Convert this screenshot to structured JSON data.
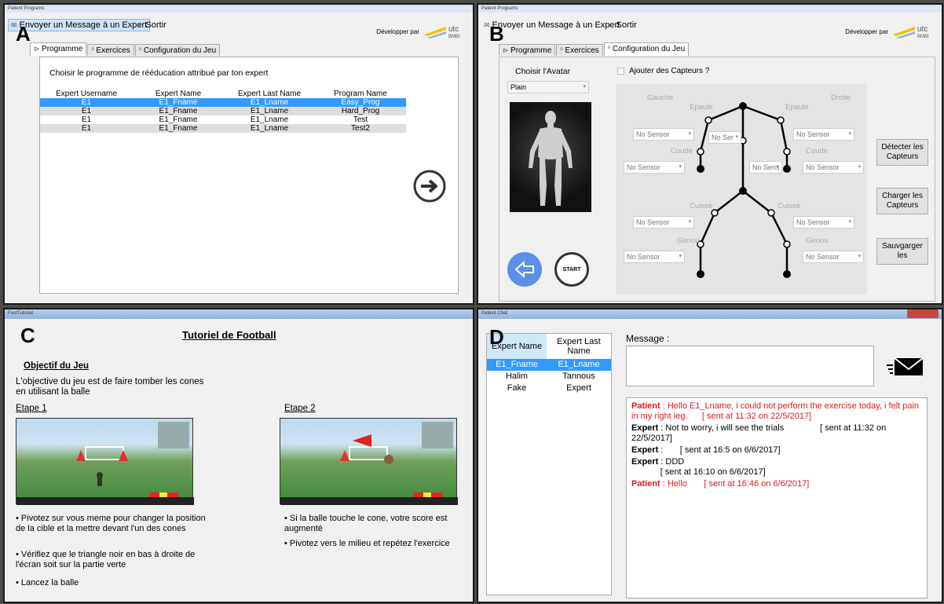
{
  "labels": {
    "a": "A",
    "b": "B",
    "c": "C",
    "d": "D"
  },
  "program_window": {
    "title": "Patient Programs",
    "menu": {
      "message": "Envoyer un Message à un Expert",
      "exit": "Sortir"
    },
    "developer": "Développer par",
    "logo_text": "utc",
    "logo_sub": "BMBI",
    "tabs": [
      "Programme",
      "Exercices",
      "Configuration du Jeu"
    ]
  },
  "panel_a": {
    "prompt": "Choisir le programme de rééducation attribué par ton expert",
    "columns": [
      "Expert Username",
      "Expert Name",
      "Expert Last Name",
      "Program Name"
    ],
    "rows": [
      [
        "E1",
        "E1_Fname",
        "E1_Lname",
        "Easy_Prog"
      ],
      [
        "E1",
        "E1_Fname",
        "E1_Lname",
        "Hard_Prog"
      ],
      [
        "E1",
        "E1_Fname",
        "E1_Lname",
        "Test"
      ],
      [
        "E1",
        "E1_Fname",
        "E1_Lname",
        "Test2"
      ]
    ],
    "selected_row": 0
  },
  "panel_b": {
    "avatar_label": "Choisir l'Avatar",
    "avatar_value": "Plain",
    "sensor_checkbox": "Ajouter des Capteurs ?",
    "side_left": "Gauche",
    "side_right": "Droite",
    "joint_shoulder": "Epaule",
    "joint_elbow": "Coude",
    "joint_thigh": "Cuisse",
    "joint_knee": "Genou",
    "sensor_default": "No Sensor",
    "sensor_short": "No Ser",
    "sensor_short2": "No Sens",
    "btn_detect": "Détecter les Capteurs",
    "btn_load": "Charger les Capteurs",
    "btn_save": "Sauvgarger les",
    "start": "START"
  },
  "panel_c": {
    "window_title": "FootTutorial",
    "title": "Tutoriel de Football",
    "objective_heading": "Objectif du Jeu",
    "objective_text": "L'objective du jeu est de faire tomber les cones en utilisant la balle",
    "step1": "Etape 1",
    "step2": "Etape 2",
    "step1_points": [
      "• Pivotez sur vous meme pour changer la position de la cible et la mettre devant l'un des cones",
      "• Vérifiez que le triangle noir en bas à droite de l'écran soit sur la partie verte",
      "• Lancez la balle"
    ],
    "step2_points": [
      "• Si la balle touche le cone, votre score est augmenté",
      "• Pivotez vers le milieu et repétez l'exercice"
    ]
  },
  "panel_d": {
    "window_title": "Patient Chat",
    "columns": [
      "Expert Name",
      "Expert Last Name"
    ],
    "experts": [
      [
        "E1_Fname",
        "E1_Lname"
      ],
      [
        "Halim",
        "Tannous"
      ],
      [
        "Fake",
        "Expert"
      ]
    ],
    "message_label": "Message :",
    "chat": [
      {
        "who": "Patient",
        "text": " : Hello E1_Lname, i could not perform the exercise today, i felt pain in my right leg.",
        "sent": "[ sent at 11:32 on 22/5/2017]",
        "color": "#e01b1b"
      },
      {
        "who": "Expert",
        "text": " : Not to worry, i will see the trials",
        "sent": "[ sent at 11:32 on 22/5/2017]",
        "color": "#000000"
      },
      {
        "who": "Expert",
        "text": " :",
        "sent": "[ sent at 16:5 on 6/6/2017]",
        "color": "#000000"
      },
      {
        "who": "Expert",
        "text": " : DDD",
        "sent": "[ sent at 16:10 on 6/6/2017]",
        "color": "#000000"
      },
      {
        "who": "Patient",
        "text": " : Hello",
        "sent": "[ sent at 16:46 on 6/6/2017]",
        "color": "#e01b1b"
      }
    ]
  }
}
